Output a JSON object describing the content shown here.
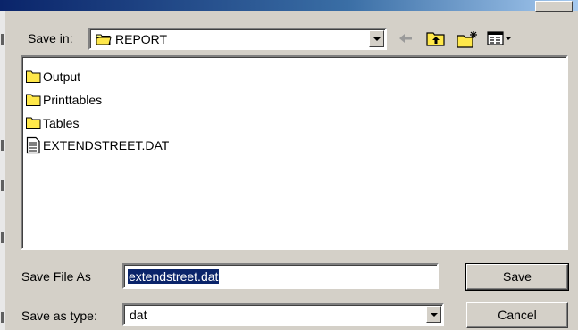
{
  "dialog": {
    "title": "",
    "accent_color": "#0a246a",
    "save_in": {
      "label": "Save in:",
      "value": "REPORT",
      "icon": "folder-icon"
    },
    "toolbar": {
      "icons": [
        "back-arrow-icon",
        "up-one-level-icon",
        "create-new-folder-icon",
        "view-menu-icon"
      ]
    },
    "files": [
      {
        "name": "Output",
        "icon": "folder-icon"
      },
      {
        "name": "Printtables",
        "icon": "folder-icon"
      },
      {
        "name": "Tables",
        "icon": "folder-icon"
      },
      {
        "name": "EXTENDSTREET.DAT",
        "icon": "document-icon"
      }
    ],
    "file_name": {
      "label": "Save File As",
      "value": "extendstreet.dat"
    },
    "file_type": {
      "label": "Save as type:",
      "value": "dat"
    },
    "save_label": "Save",
    "cancel_label": "Cancel"
  }
}
